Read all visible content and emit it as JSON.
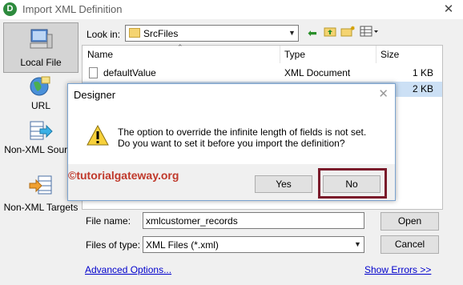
{
  "window": {
    "title": "Import XML Definition",
    "app_icon_letter": "D"
  },
  "places": [
    {
      "label": "Local File",
      "icon": "computer-icon",
      "selected": true
    },
    {
      "label": "URL",
      "icon": "globe-icon",
      "selected": false
    },
    {
      "label": "Non-XML Source",
      "icon": "arrow-table-icon",
      "selected": false
    },
    {
      "label": "Non-XML Targets",
      "icon": "table-arrow-icon",
      "selected": false
    }
  ],
  "lookin": {
    "label": "Look in:",
    "value": "SrcFiles"
  },
  "filelist": {
    "columns": [
      "Name",
      "Type",
      "Size"
    ],
    "rows": [
      {
        "name": "defaultValue",
        "type": "XML Document",
        "size": "1 KB"
      },
      {
        "name": "",
        "type": "",
        "size": "2 KB"
      }
    ]
  },
  "form": {
    "filename_label": "File name:",
    "filename_value": "xmlcustomer_records",
    "filetype_label": "Files of type:",
    "filetype_value": "XML Files (*.xml)",
    "open_label": "Open",
    "cancel_label": "Cancel",
    "advanced_link": "Advanced Options...",
    "show_errors_link": "Show Errors >>"
  },
  "dialog": {
    "title": "Designer",
    "line1": "The option to override the infinite length of fields is not set.",
    "line2": "Do you want to set it before you import the definition?",
    "yes_label": "Yes",
    "no_label": "No",
    "watermark": "©tutorialgateway.org",
    "highlight_color": "#7a1a2a"
  }
}
